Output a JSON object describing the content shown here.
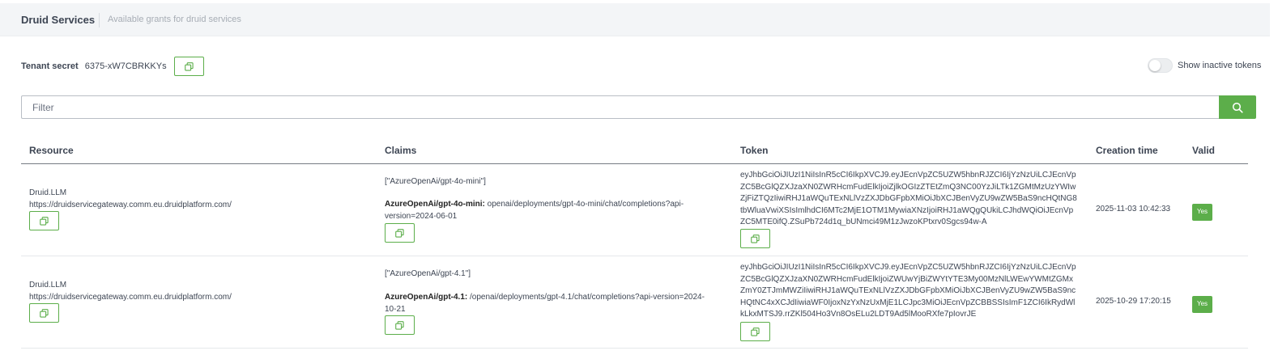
{
  "header": {
    "title": "Druid Services",
    "subtitle": "Available grants for druid services"
  },
  "tenant": {
    "label": "Tenant secret",
    "value": "6375-xW7CBRKKYs"
  },
  "toggle": {
    "label": "Show inactive tokens",
    "on": false
  },
  "filter": {
    "placeholder": "Filter",
    "value": ""
  },
  "table": {
    "columns": [
      "Resource",
      "Claims",
      "Token",
      "Creation time",
      "Valid"
    ],
    "rows": [
      {
        "resource_name": "Druid.LLM",
        "resource_url": "https://druidservicegateway.comm.eu.druidplatform.com/",
        "claims_array": "[\"AzureOpenAi/gpt-4o-mini\"]",
        "claim_key": "AzureOpenAi/gpt-4o-mini:",
        "claim_value_1": " openai/deployments/gpt-4o-mini/chat/completions?api-",
        "claim_value_2": "version=2024-06-01",
        "token_lines": [
          "eyJhbGciOiJIUzI1NiIsInR5cCI6IkpXVCJ9.eyJEcnVpZC5UZW5hbnRJZCI6IjYzNzUiLCJEcnVp",
          "ZC5BcGlQZXJzaXN0ZWRHcmFudElkIjoiZjlkOGIzZTEtZmQ3NC00YzJiLTk1ZGMtMzUzYWIw",
          "ZjFiZTQzIiwiRHJ1aWQuTExNLlVzZXJDbGFpbXMiOiJbXCJBenVyZU9wZW5BaS9ncHQtNG8",
          "tbWluaVwiXSIsImlhdCI6MTc2MjE1OTM1MywiaXNzIjoiRHJ1aWQgQUkiLCJhdWQiOiJEcnVp",
          "ZC5MTE0ifQ.ZSuPb724d1q_bUNmci49M1zJwzoKPtxrv0Sgcs94w-A"
        ],
        "creation_time": "2025-11-03 10:42:33",
        "valid": "Yes"
      },
      {
        "resource_name": "Druid.LLM",
        "resource_url": "https://druidservicegateway.comm.eu.druidplatform.com/",
        "claims_array": "[\"AzureOpenAi/gpt-4.1\"]",
        "claim_key": "AzureOpenAi/gpt-4.1:",
        "claim_value_1": " /openai/deployments/gpt-4.1/chat/completions?api-version=2024-",
        "claim_value_2": "10-21",
        "token_lines": [
          "eyJhbGciOiJIUzI1NiIsInR5cCI6IkpXVCJ9.eyJEcnVpZC5UZW5hbnRJZCI6IjYzNzUiLCJEcnVp",
          "ZC5BcGlQZXJzaXN0ZWRHcmFudElkIjoiZWUwYjBiZWYtYTE3My00MzNlLWEwYWMtZGMx",
          "ZmY0ZTJmMWZiIiwiRHJ1aWQuTExNLlVzZXJDbGFpbXMiOiJbXCJBenVyZU9wZW5BaS9nc",
          "HQtNC4xXCJdIiwiaWF0IjoxNzYxNzUxMjE1LCJpc3MiOiJEcnVpZCBBSSIsImF1ZCI6IkRydWl",
          "kLkxMTSJ9.rrZKl504Ho3Vn8OsELu2LDT9Ad5lMooRXfe7pIovrJE"
        ],
        "creation_time": "2025-10-29 17:20:15",
        "valid": "Yes"
      }
    ]
  },
  "colors": {
    "accent": "#5cae4a",
    "header_bg": "#f3f5f7"
  }
}
